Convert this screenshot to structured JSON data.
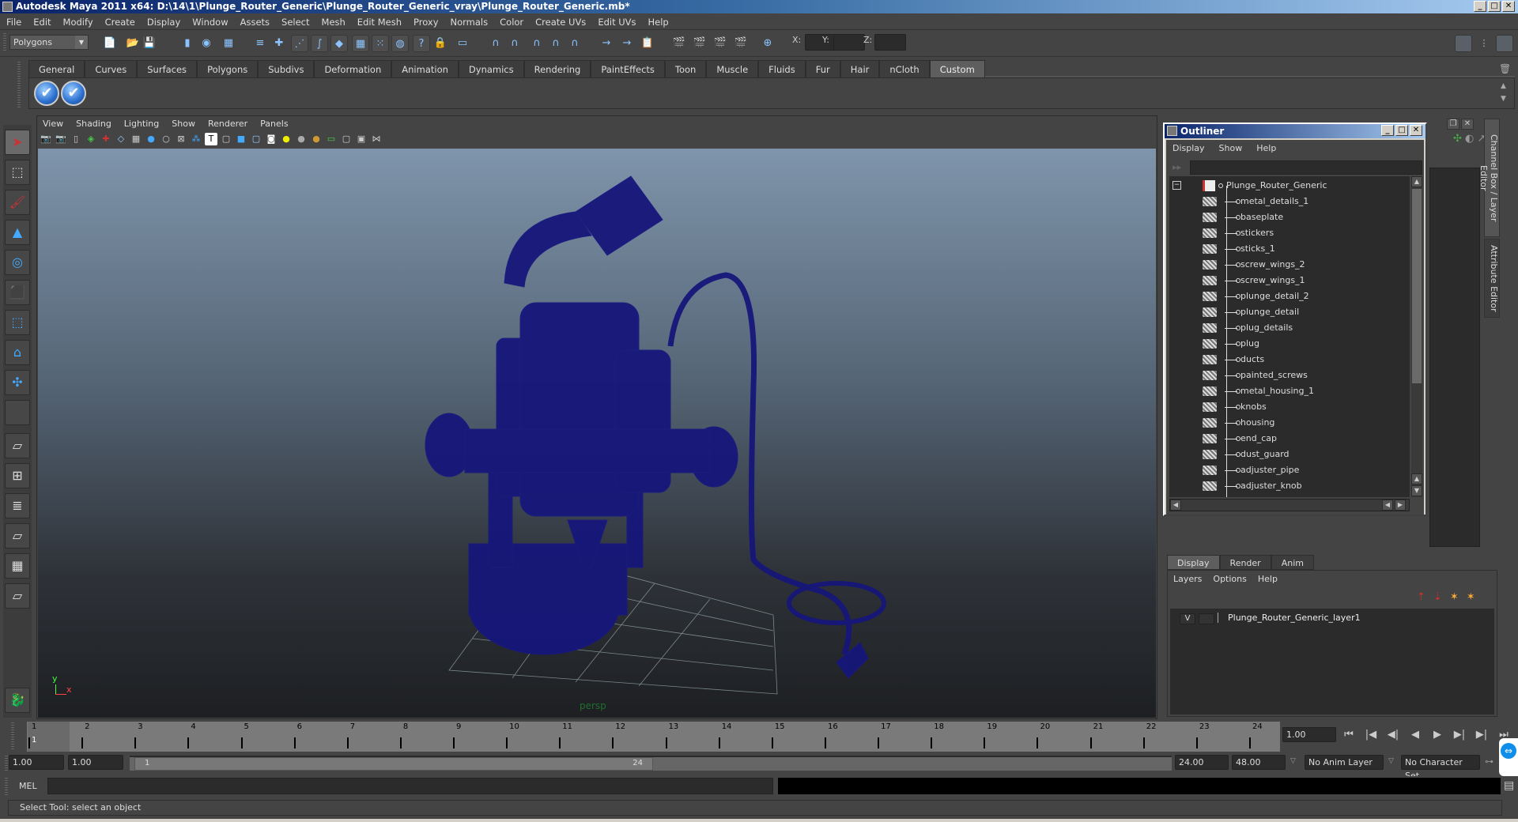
{
  "window": {
    "title": "Autodesk Maya 2011 x64: D:\\14\\1\\Plunge_Router_Generic\\Plunge_Router_Generic_vray\\Plunge_Router_Generic.mb*",
    "minimize": "_",
    "maximize": "□",
    "close": "✕"
  },
  "menubar": [
    "File",
    "Edit",
    "Modify",
    "Create",
    "Display",
    "Window",
    "Assets",
    "Select",
    "Mesh",
    "Edit Mesh",
    "Proxy",
    "Normals",
    "Color",
    "Create UVs",
    "Edit UVs",
    "Help"
  ],
  "statusline": {
    "mode": "Polygons",
    "x_label": "X:",
    "y_label": "Y:",
    "z_label": "Z:",
    "x_value": "",
    "y_value": "",
    "z_value": "",
    "icons": [
      "new-scene-icon",
      "open-scene-icon",
      "save-scene-icon",
      "select-by-hierarchy-icon",
      "select-by-object-icon",
      "select-by-component-icon",
      "snap-grid-icon",
      "snap-curve-icon",
      "snap-point-icon",
      "snap-plane-icon",
      "snap-live-icon",
      "history-icon",
      "render-view-icon",
      "render-icon",
      "ipr-icon",
      "render-settings-icon"
    ]
  },
  "shelf": {
    "tabs": [
      "General",
      "Curves",
      "Surfaces",
      "Polygons",
      "Subdivs",
      "Deformation",
      "Animation",
      "Dynamics",
      "Rendering",
      "PaintEffects",
      "Toon",
      "Muscle",
      "Fluids",
      "Fur",
      "Hair",
      "nCloth",
      "Custom"
    ],
    "active_tab": "Custom",
    "buttons": [
      "check-icon",
      "check-icon"
    ]
  },
  "toolbox": [
    "select-tool",
    "lasso-tool",
    "paint-select-tool",
    "move-tool",
    "rotate-tool",
    "scale-tool",
    "universal-manipulator",
    "soft-mod-tool",
    "show-manipulator",
    "last-tool",
    "single-perspective-layout",
    "four-view-layout",
    "outliner-persp-layout",
    "graph-persp-layout",
    "hypershade-layout",
    "outliner-graph-layout"
  ],
  "viewport": {
    "menu": [
      "View",
      "Shading",
      "Lighting",
      "Show",
      "Renderer",
      "Panels"
    ],
    "camera_label": "persp",
    "axis_y": "y",
    "axis_x": "x"
  },
  "outliner": {
    "title": "Outliner",
    "menu": [
      "Display",
      "Show",
      "Help"
    ],
    "filter": "",
    "root": "Plunge_Router_Generic",
    "items": [
      "metal_details_1",
      "baseplate",
      "stickers",
      "sticks_1",
      "screw_wings_2",
      "screw_wings_1",
      "plunge_detail_2",
      "plunge_detail",
      "plug_details",
      "plug",
      "ducts",
      "painted_screws",
      "metal_housing_1",
      "knobs",
      "housing",
      "end_cap",
      "dust_guard",
      "adjuster_pipe",
      "adjuster_knob"
    ]
  },
  "side_tabs": {
    "channel_box": "Channel Box / Layer Editor",
    "attribute_editor": "Attribute Editor"
  },
  "layer_editor": {
    "tabs": [
      "Display",
      "Render",
      "Anim"
    ],
    "active_tab": "Display",
    "menu": [
      "Layers",
      "Options",
      "Help"
    ],
    "layers": [
      {
        "visible": "V",
        "name": "Plunge_Router_Generic_layer1"
      }
    ]
  },
  "timeslider": {
    "ticks": [
      "1",
      "2",
      "3",
      "4",
      "5",
      "6",
      "7",
      "8",
      "9",
      "10",
      "11",
      "12",
      "13",
      "14",
      "15",
      "16",
      "17",
      "18",
      "19",
      "20",
      "21",
      "22",
      "23",
      "24"
    ],
    "current_frame_label": "1",
    "current_time": "1.00"
  },
  "range": {
    "start_time": "1.00",
    "playback_start": "1.00",
    "range_start_label": "1",
    "range_end_label": "24",
    "playback_end": "24.00",
    "end_time": "48.00",
    "anim_layer": "No Anim Layer",
    "character_set": "No Character Set"
  },
  "playback": [
    "⏮",
    "|◀",
    "◀|",
    "◀",
    "▶",
    "▶|",
    "▶|",
    "⏭"
  ],
  "command_line": {
    "label": "MEL",
    "value": "",
    "output": ""
  },
  "helpline": "Select Tool: select an object"
}
